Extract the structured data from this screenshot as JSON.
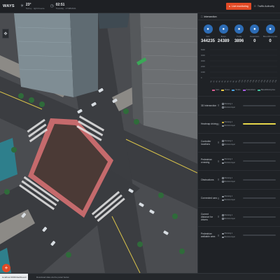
{
  "app": {
    "brand": "WAYS"
  },
  "topbar": {
    "metric1": {
      "value": "23°",
      "sub": "Sunny · light breeze"
    },
    "metric2": {
      "value": "02:51",
      "sub": "Tuesday · 17/08/2021"
    },
    "live_button": "Live monitoring",
    "user_button": "Traffic Authority"
  },
  "panel": {
    "title": "Intersection",
    "kpis": [
      {
        "icon": "car-icon",
        "label": "Cars",
        "value": "344235"
      },
      {
        "icon": "bus-icon",
        "label": "Buses",
        "value": "24389"
      },
      {
        "icon": "truck-icon",
        "label": "Trucks",
        "value": "3896"
      },
      {
        "icon": "pedestrian-icon",
        "label": "Pedestrians",
        "value": "0"
      },
      {
        "icon": "bike-icon",
        "label": "Bikes/Motorcycles",
        "value": "0"
      }
    ],
    "legend": [
      {
        "label": "Cars",
        "color": "#d65c8f"
      },
      {
        "label": "Buses",
        "color": "#e6c744"
      },
      {
        "label": "Trucks",
        "color": "#4aa2e0"
      },
      {
        "label": "Pedestrians",
        "color": "#a45be0"
      },
      {
        "label": "Bikes/Motorcycles",
        "color": "#3fbf9a"
      }
    ],
    "layers": [
      {
        "name": "3D Intersection",
        "on": false,
        "fill": 0.0
      },
      {
        "name": "Heatmap driving",
        "on": true,
        "fill": 1.0
      },
      {
        "name": "Controller locations",
        "on": false,
        "fill": 0.0
      },
      {
        "name": "Pedestrian crossing",
        "on": false,
        "fill": 0.0
      },
      {
        "name": "Obstructions",
        "on": false,
        "fill": 0.0
      },
      {
        "name": "Connected cars",
        "on": false,
        "fill": 0.0
      },
      {
        "name": "Current distance for drivers",
        "on": false,
        "fill": 0.0
      },
      {
        "name": "Pedestrian walkable area",
        "on": false,
        "fill": 0.0
      }
    ],
    "option_on": "Showing 1",
    "option_off": "Remove layer"
  },
  "status": {
    "url": "localhost:3000/dashboard",
    "message": "Download data via the panel below"
  },
  "chart_data": {
    "type": "bar",
    "categories": [
      "0h",
      "1h",
      "2h",
      "3h",
      "4h",
      "5h",
      "6h",
      "7h",
      "8h",
      "9h",
      "10h",
      "11h",
      "12h",
      "13h",
      "14h",
      "15h",
      "16h",
      "17h",
      "18h",
      "19h",
      "20h",
      "21h",
      "22h",
      "23h"
    ],
    "series": [
      {
        "name": "Cars",
        "values": [
          0,
          0,
          0,
          0,
          0,
          0,
          0,
          0,
          0,
          0,
          0,
          0,
          0,
          0,
          0,
          0,
          0,
          0,
          0,
          0,
          0,
          0,
          0,
          0
        ]
      }
    ],
    "ylim": [
      0,
      5000
    ],
    "ytick_labels": [
      "5000",
      "4000",
      "3000",
      "2000",
      "1000",
      "0"
    ]
  }
}
